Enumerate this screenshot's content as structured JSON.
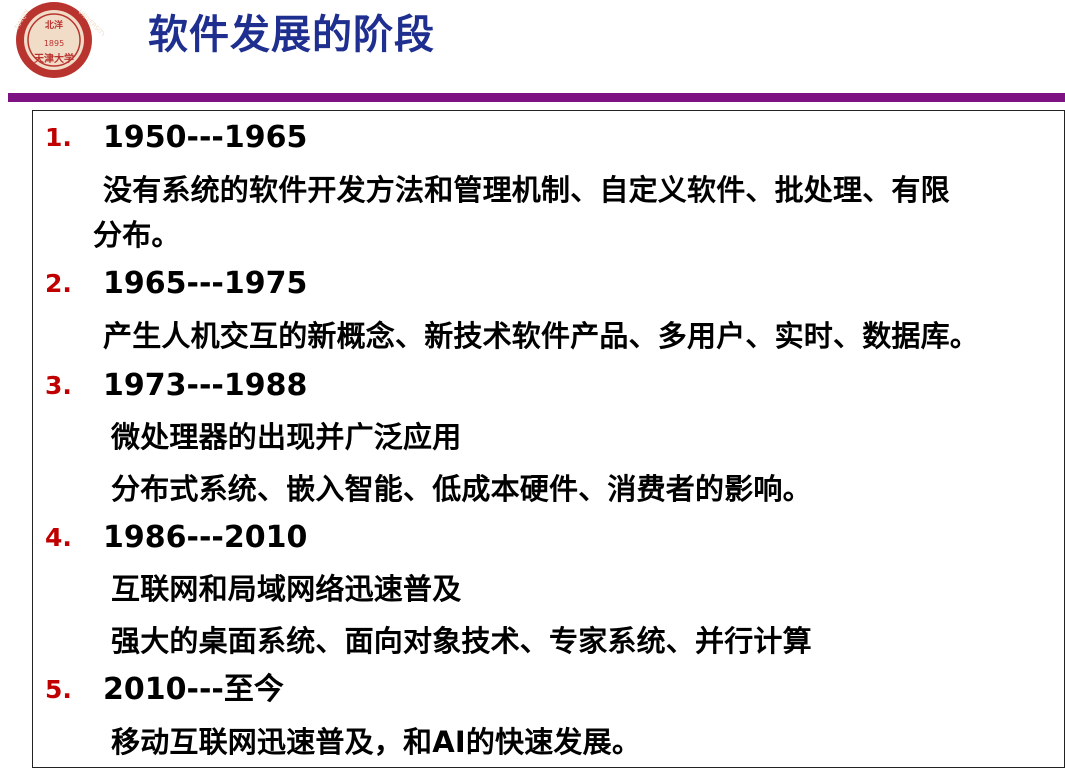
{
  "logo": {
    "alt_text": "天津大学",
    "year": "1895",
    "colors": {
      "outer": "#b9342f",
      "inner": "#f1dcc8"
    }
  },
  "header": {
    "title": "软件发展的阶段"
  },
  "colors": {
    "title": "#1f2f8f",
    "divider": "#7d1383",
    "number": "#c00000",
    "text": "#000000"
  },
  "stages": [
    {
      "number": "1.",
      "years": "1950---1965",
      "lines": [
        "没有系统的软件开发方法和管理机制、自定义软件、批处理、有限",
        "分布。"
      ]
    },
    {
      "number": "2.",
      "years": "1965---1975",
      "lines": [
        "产生人机交互的新概念、新技术软件产品、多用户、实时、数据库。"
      ]
    },
    {
      "number": "3.",
      "years": "1973---1988",
      "lines": [
        "微处理器的出现并广泛应用",
        "分布式系统、嵌入智能、低成本硬件、消费者的影响。"
      ]
    },
    {
      "number": "4.",
      "years": "1986---2010",
      "lines": [
        "互联网和局域网络迅速普及",
        "强大的桌面系统、面向对象技术、专家系统、并行计算"
      ]
    },
    {
      "number": "5.",
      "years": "2010---至今",
      "lines": [
        "移动互联网迅速普及，和AI的快速发展。"
      ]
    }
  ]
}
